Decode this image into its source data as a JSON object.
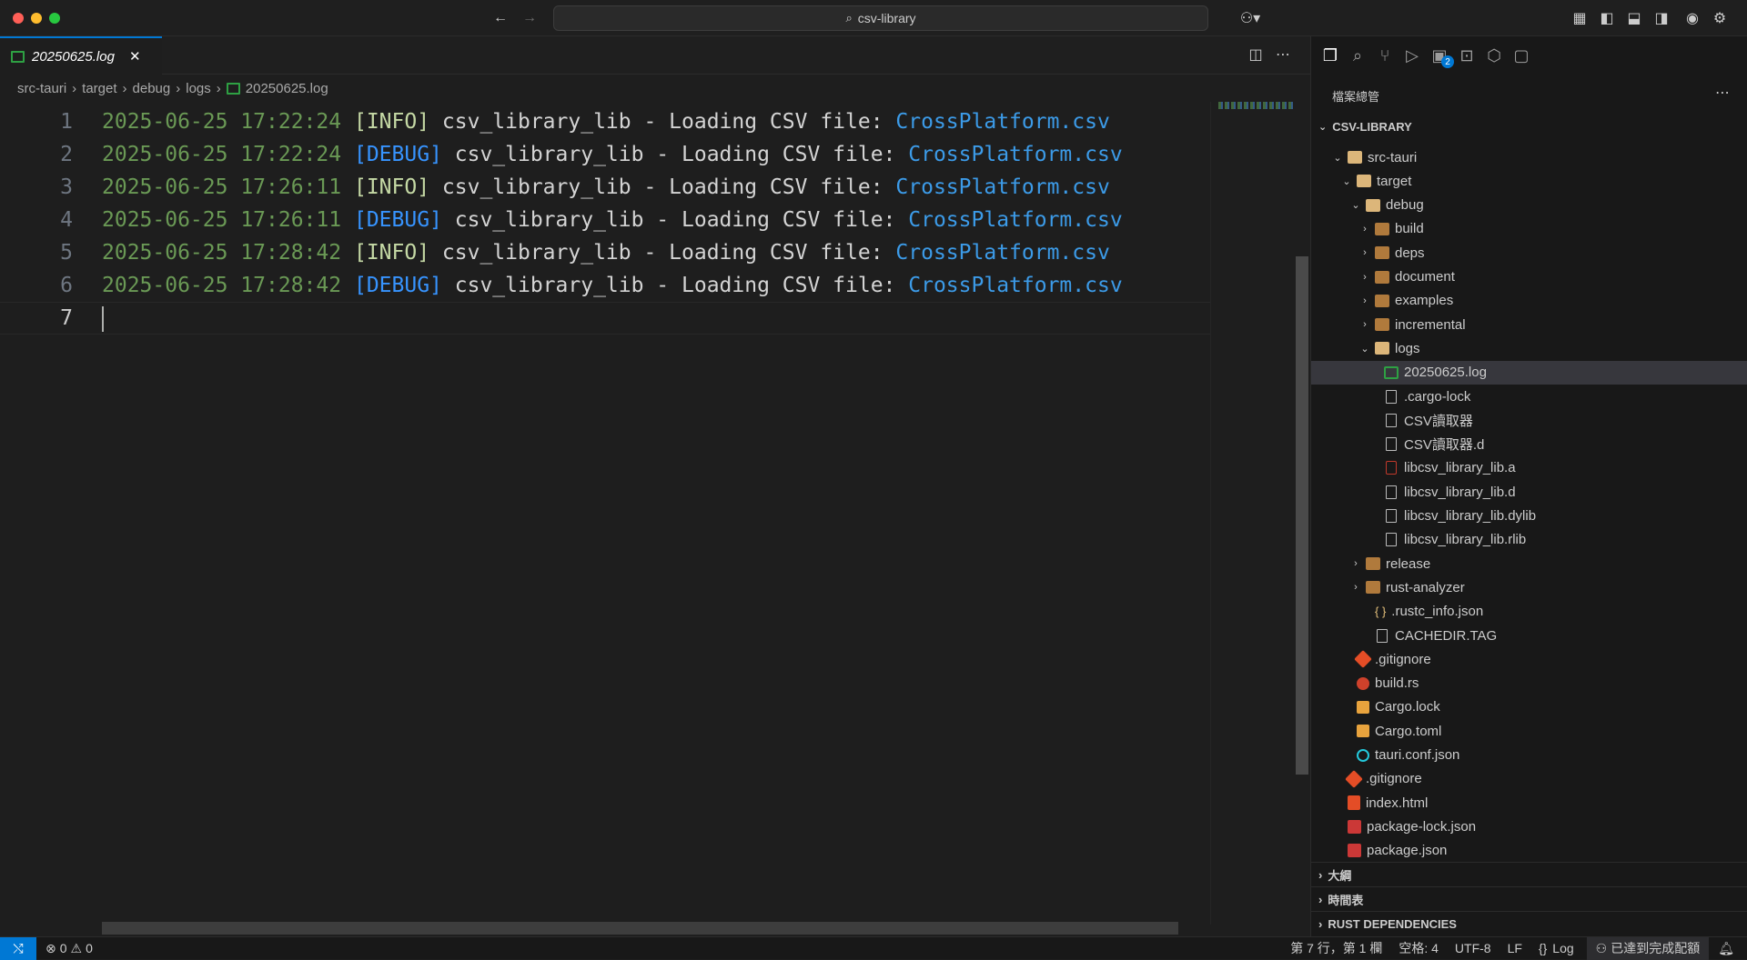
{
  "titlebar": {
    "search_text": "csv-library"
  },
  "tab": {
    "label": "20250625.log"
  },
  "breadcrumb": [
    "src-tauri",
    "target",
    "debug",
    "logs",
    "20250625.log"
  ],
  "editor": {
    "lines": [
      {
        "num": "1",
        "ts": "2025-06-25 17:22:24",
        "level": "[INFO]",
        "level_type": "info",
        "msg": " csv_library_lib - Loading CSV file: ",
        "file": "CrossPlatform.csv"
      },
      {
        "num": "2",
        "ts": "2025-06-25 17:22:24",
        "level": "[DEBUG]",
        "level_type": "debug",
        "msg": " csv_library_lib - Loading CSV file: ",
        "file": "CrossPlatform.csv"
      },
      {
        "num": "3",
        "ts": "2025-06-25 17:26:11",
        "level": "[INFO]",
        "level_type": "info",
        "msg": " csv_library_lib - Loading CSV file: ",
        "file": "CrossPlatform.csv"
      },
      {
        "num": "4",
        "ts": "2025-06-25 17:26:11",
        "level": "[DEBUG]",
        "level_type": "debug",
        "msg": " csv_library_lib - Loading CSV file: ",
        "file": "CrossPlatform.csv"
      },
      {
        "num": "5",
        "ts": "2025-06-25 17:28:42",
        "level": "[INFO]",
        "level_type": "info",
        "msg": " csv_library_lib - Loading CSV file: ",
        "file": "CrossPlatform.csv"
      },
      {
        "num": "6",
        "ts": "2025-06-25 17:28:42",
        "level": "[DEBUG]",
        "level_type": "debug",
        "msg": " csv_library_lib - Loading CSV file: ",
        "file": "CrossPlatform.csv"
      },
      {
        "num": "7",
        "ts": "",
        "level": "",
        "level_type": "",
        "msg": "",
        "file": ""
      }
    ]
  },
  "explorer": {
    "title": "檔案總管",
    "badge": "2",
    "root": "CSV-LIBRARY",
    "items": [
      {
        "label": "src-tauri",
        "depth": 0,
        "kind": "folder-open",
        "chevron": "open"
      },
      {
        "label": "target",
        "depth": 1,
        "kind": "folder-open",
        "chevron": "open"
      },
      {
        "label": "debug",
        "depth": 2,
        "kind": "folder-open",
        "chevron": "open"
      },
      {
        "label": "build",
        "depth": 3,
        "kind": "folder",
        "chevron": "closed"
      },
      {
        "label": "deps",
        "depth": 3,
        "kind": "folder",
        "chevron": "closed"
      },
      {
        "label": "document",
        "depth": 3,
        "kind": "folder",
        "chevron": "closed"
      },
      {
        "label": "examples",
        "depth": 3,
        "kind": "folder",
        "chevron": "closed"
      },
      {
        "label": "incremental",
        "depth": 3,
        "kind": "folder",
        "chevron": "closed"
      },
      {
        "label": "logs",
        "depth": 3,
        "kind": "folder-open",
        "chevron": "open"
      },
      {
        "label": "20250625.log",
        "depth": 4,
        "kind": "log",
        "chevron": "none",
        "selected": true
      },
      {
        "label": ".cargo-lock",
        "depth": 4,
        "kind": "doc",
        "chevron": "none"
      },
      {
        "label": "CSV讀取器",
        "depth": 4,
        "kind": "doc",
        "chevron": "none"
      },
      {
        "label": "CSV讀取器.d",
        "depth": 4,
        "kind": "doc",
        "chevron": "none"
      },
      {
        "label": "libcsv_library_lib.a",
        "depth": 4,
        "kind": "binary",
        "chevron": "none"
      },
      {
        "label": "libcsv_library_lib.d",
        "depth": 4,
        "kind": "doc",
        "chevron": "none"
      },
      {
        "label": "libcsv_library_lib.dylib",
        "depth": 4,
        "kind": "doc",
        "chevron": "none"
      },
      {
        "label": "libcsv_library_lib.rlib",
        "depth": 4,
        "kind": "doc",
        "chevron": "none"
      },
      {
        "label": "release",
        "depth": 2,
        "kind": "folder",
        "chevron": "closed"
      },
      {
        "label": "rust-analyzer",
        "depth": 2,
        "kind": "folder",
        "chevron": "closed"
      },
      {
        "label": ".rustc_info.json",
        "depth": 3,
        "kind": "json",
        "chevron": "none"
      },
      {
        "label": "CACHEDIR.TAG",
        "depth": 3,
        "kind": "doc",
        "chevron": "none"
      },
      {
        "label": ".gitignore",
        "depth": 1,
        "kind": "git",
        "chevron": "none"
      },
      {
        "label": "build.rs",
        "depth": 1,
        "kind": "rust",
        "chevron": "none"
      },
      {
        "label": "Cargo.lock",
        "depth": 1,
        "kind": "cargo",
        "chevron": "none"
      },
      {
        "label": "Cargo.toml",
        "depth": 1,
        "kind": "cargo",
        "chevron": "none"
      },
      {
        "label": "tauri.conf.json",
        "depth": 1,
        "kind": "tauri",
        "chevron": "none"
      },
      {
        "label": ".gitignore",
        "depth": 0,
        "kind": "git",
        "chevron": "none"
      },
      {
        "label": "index.html",
        "depth": 0,
        "kind": "html",
        "chevron": "none"
      },
      {
        "label": "package-lock.json",
        "depth": 0,
        "kind": "npm",
        "chevron": "none"
      },
      {
        "label": "package.json",
        "depth": 0,
        "kind": "npm",
        "chevron": "none"
      }
    ],
    "sections": [
      "大綱",
      "時間表",
      "RUST DEPENDENCIES"
    ]
  },
  "statusbar": {
    "errors": "0",
    "warnings": "0",
    "position": "第 7 行，第 1 欄",
    "spaces": "空格: 4",
    "encoding": "UTF-8",
    "eol": "LF",
    "language": "Log",
    "copilot": "已達到完成配額"
  },
  "colors": {
    "accent": "#0078d4",
    "timestamp": "#6a9955",
    "info": "#c5d9a5",
    "debug": "#3794ff",
    "filename": "#3c9be8"
  }
}
